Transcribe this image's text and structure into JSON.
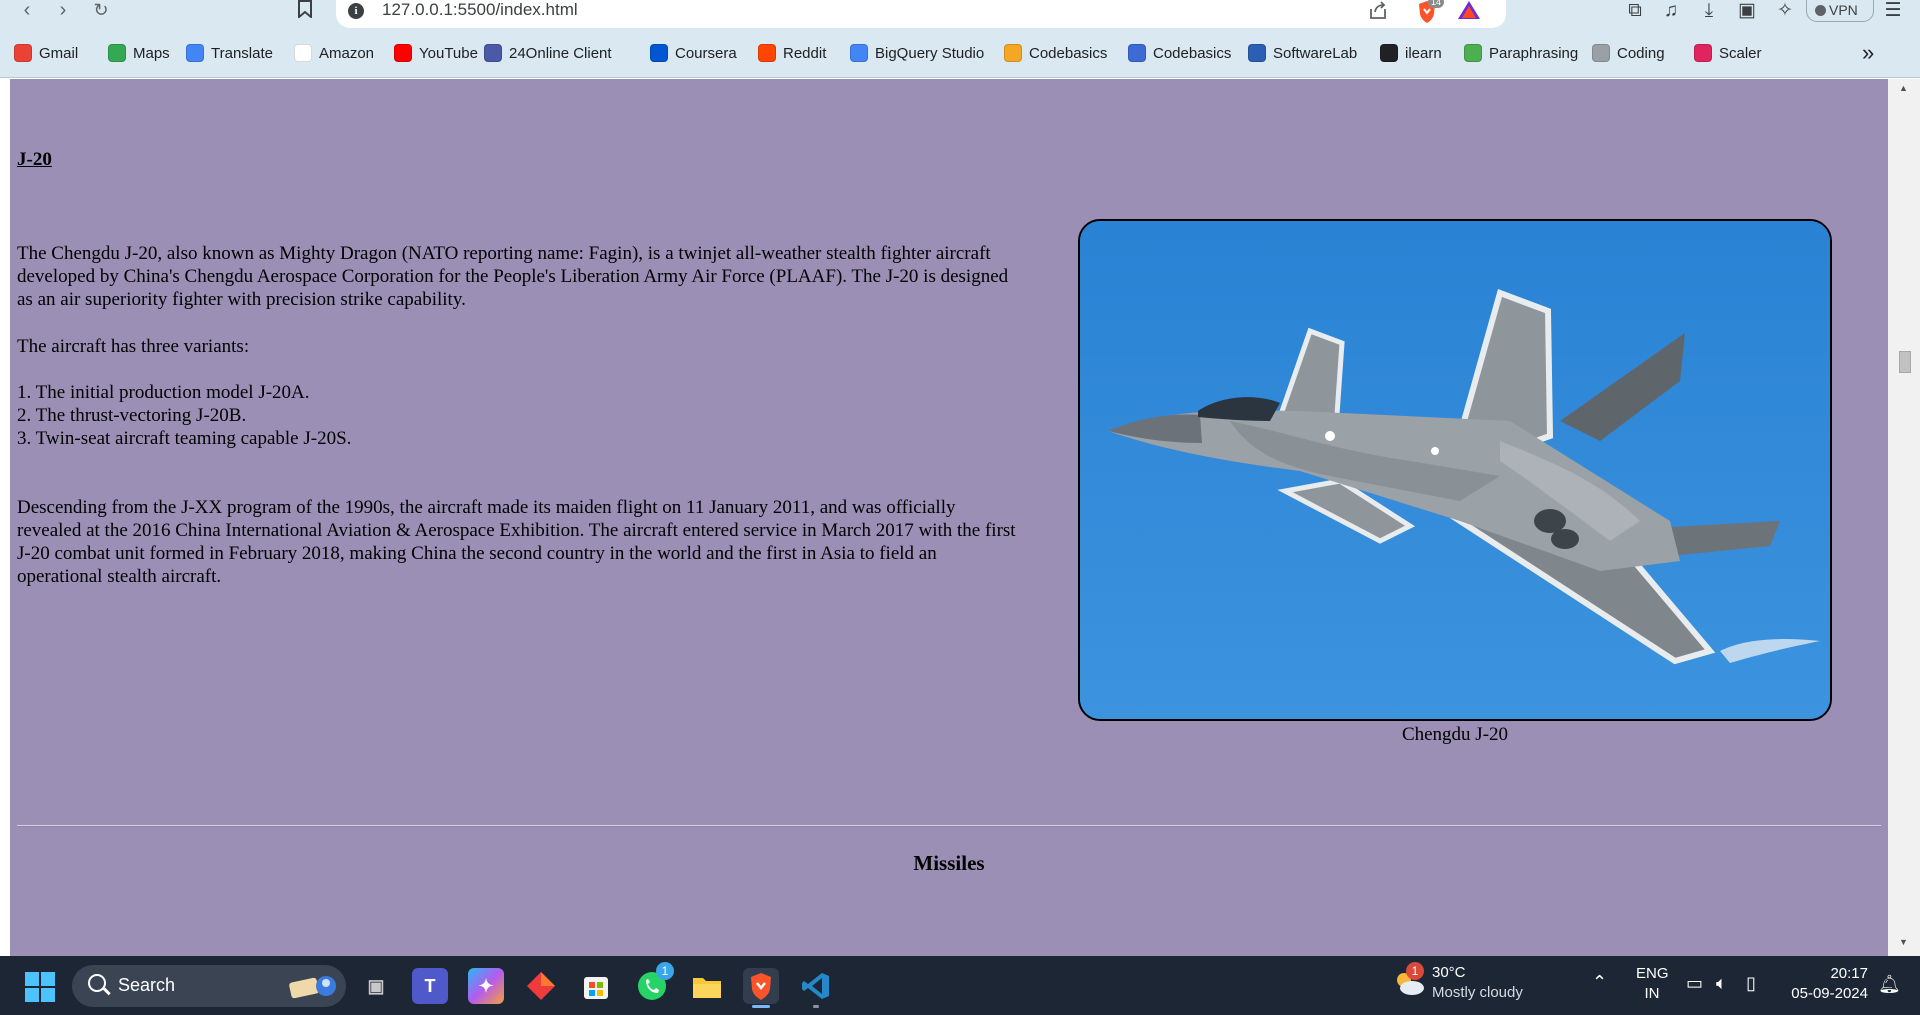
{
  "browser": {
    "url": "127.0.0.1:5500/index.html",
    "brave_shield_count": "14",
    "vpn_label": "VPN",
    "bookmarks": [
      {
        "label": "Gmail",
        "icon": "gmail-icon",
        "color": "#ea4335"
      },
      {
        "label": "Maps",
        "icon": "maps-icon",
        "color": "#34a853"
      },
      {
        "label": "Translate",
        "icon": "translate-icon",
        "color": "#4285f4"
      },
      {
        "label": "Amazon",
        "icon": "amazon-icon",
        "color": "#ffffff"
      },
      {
        "label": "YouTube",
        "icon": "youtube-icon",
        "color": "#ff0000"
      },
      {
        "label": "24Online Client",
        "icon": "24online-icon",
        "color": "#4a5aa8"
      },
      {
        "label": "Coursera",
        "icon": "coursera-icon",
        "color": "#0056d2"
      },
      {
        "label": "Reddit",
        "icon": "reddit-icon",
        "color": "#ff4500"
      },
      {
        "label": "BigQuery Studio",
        "icon": "bigquery-icon",
        "color": "#4285f4"
      },
      {
        "label": "Codebasics",
        "icon": "rocket-icon",
        "color": "#f5a623"
      },
      {
        "label": "Codebasics",
        "icon": "codebasics-icon",
        "color": "#3d6bd6"
      },
      {
        "label": "SoftwareLab",
        "icon": "softwarelab-icon",
        "color": "#2b5fb3"
      },
      {
        "label": "ilearn",
        "icon": "globe-icon",
        "color": "#202124"
      },
      {
        "label": "Paraphrasing",
        "icon": "paraphrasing-icon",
        "color": "#4caf50"
      },
      {
        "label": "Coding",
        "icon": "coding-icon",
        "color": "#9aa0a6"
      },
      {
        "label": "Scaler",
        "icon": "scaler-icon",
        "color": "#e0245e"
      }
    ]
  },
  "page": {
    "section_title": "J-20",
    "paragraph_1": "The Chengdu J-20, also known as Mighty Dragon (NATO reporting name: Fagin), is a twinjet all-weather stealth fighter aircraft developed by China's Chengdu Aerospace Corporation for the People's Liberation Army Air Force (PLAAF). The J-20 is designed as an air superiority fighter with precision strike capability.",
    "paragraph_2": "The aircraft has three variants:",
    "variants": [
      "1. The initial production model J-20A.",
      "2. The thrust-vectoring J-20B.",
      "3. Twin-seat aircraft teaming capable J-20S."
    ],
    "paragraph_3": "Descending from the J-XX program of the 1990s, the aircraft made its maiden flight on 11 January 2011, and was officially revealed at the 2016 China International Aviation & Aerospace Exhibition. The aircraft entered service in March 2017 with the first J-20 combat unit formed in February 2018, making China the second country in the world and the first in Asia to field an operational stealth aircraft.",
    "image_caption": "Chengdu J-20",
    "next_heading": "Missiles",
    "background_color": "#9b8fb6"
  },
  "taskbar": {
    "search_label": "Search",
    "whatsapp_badge": "1",
    "weather_badge": "1",
    "weather_temp": "30°C",
    "weather_desc": "Mostly cloudy",
    "lang_1": "ENG",
    "lang_2": "IN",
    "time": "20:17",
    "date": "05-09-2024"
  }
}
